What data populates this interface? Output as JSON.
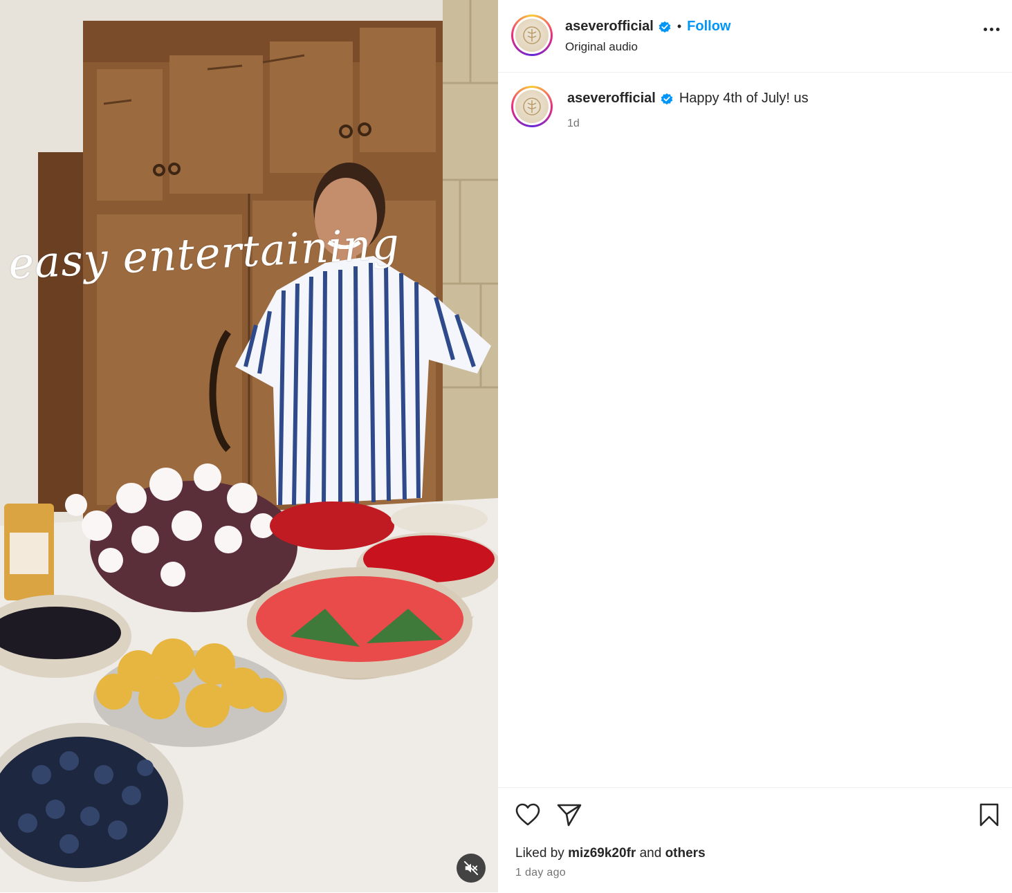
{
  "post": {
    "author": {
      "username": "aseverofficial",
      "verified": true,
      "avatar_icon": "brand-logo-icon"
    },
    "header": {
      "separator": "•",
      "follow_label": "Follow",
      "audio_label": "Original audio"
    },
    "caption": {
      "username": "aseverofficial",
      "text": "Happy 4th of July! us",
      "time": "1d"
    },
    "media": {
      "overlay_text": "easy entertaining",
      "mute_icon": "speaker-muted-icon"
    },
    "actions": {
      "like_icon": "heart-icon",
      "share_icon": "paper-plane-icon",
      "save_icon": "bookmark-icon",
      "more_icon": "more-horizontal-icon"
    },
    "likes": {
      "prefix": "Liked by",
      "user": "miz69k20fr",
      "joiner": "and",
      "others": "others"
    },
    "posted_ago": "1 day ago"
  },
  "colors": {
    "link_blue": "#0095f6",
    "text_primary": "#262626",
    "text_secondary": "#737373",
    "verified_blue": "#0095f6",
    "divider": "#efefef"
  }
}
